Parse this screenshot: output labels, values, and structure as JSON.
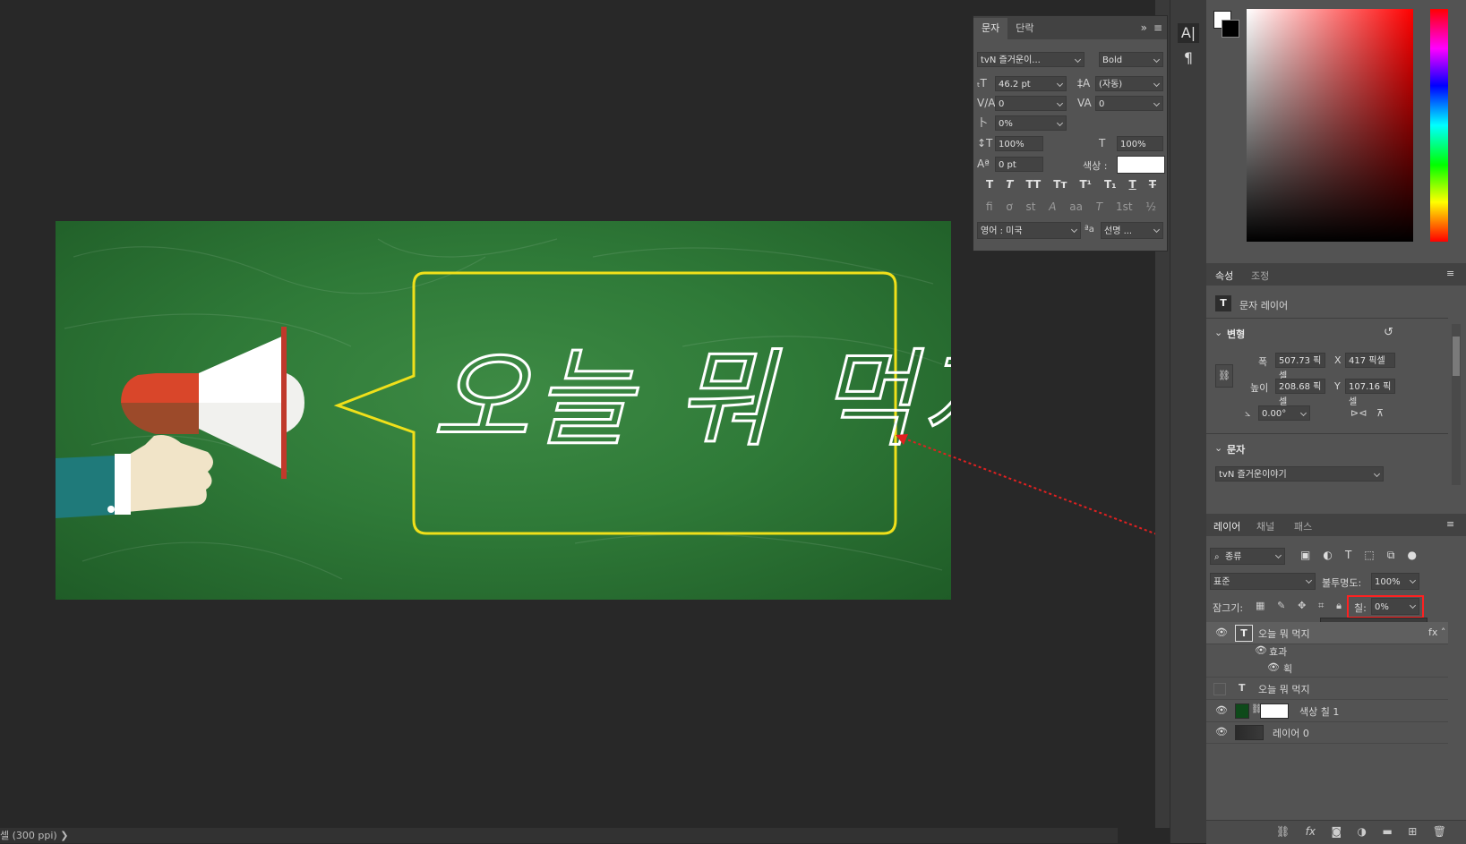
{
  "artboard": {
    "headline": "오늘 뭐 먹지",
    "colors": {
      "board": "#2f7a38",
      "bubble_stroke": "#f0e01a",
      "text_stroke": "#ffffff",
      "arrow": "#e02020"
    }
  },
  "status_bar": {
    "text": "셀 (300 ppi) ❯"
  },
  "character_panel": {
    "tabs": [
      "문자",
      "단락"
    ],
    "font_family": "tvN 즐거운이...",
    "font_style": "Bold",
    "font_size": "46.2 pt",
    "leading": "(자동)",
    "kerning": "0",
    "tracking": "0",
    "tsume": "0%",
    "vertical_scale": "100%",
    "horizontal_scale": "100%",
    "baseline_shift": "0 pt",
    "color_label": "색상 :",
    "color_value": "#ffffff",
    "style_buttons": [
      "T",
      "T",
      "TT",
      "Tт",
      "T¹",
      "T₁",
      "T",
      "T"
    ],
    "opentype_buttons": [
      "fi",
      "ơ",
      "st",
      "A",
      "aa",
      "T",
      "1st",
      "½"
    ],
    "language": "영어 : 미국",
    "antialias_icon": "ªa",
    "antialias": "선명 ..."
  },
  "tools": {
    "items": [
      "A|",
      "¶"
    ]
  },
  "properties_panel": {
    "tabs": [
      "속성",
      "조정"
    ],
    "layer_type": "문자 레이어",
    "transform_title": "변형",
    "width_label": "폭",
    "width_value": "507.73 픽셀",
    "x_label": "X",
    "x_value": "417 픽셀",
    "height_label": "높이",
    "height_value": "208.68 픽셀",
    "y_label": "Y",
    "y_value": "107.16 픽셀",
    "angle_value": "0.00°",
    "text_title": "문자",
    "font_value": "tvN 즐거운이야기"
  },
  "layers_panel": {
    "tabs": [
      "레이어",
      "채널",
      "패스"
    ],
    "filter_kind": "종류",
    "blend_mode": "표준",
    "opacity_label": "불투명도:",
    "opacity_value": "100%",
    "lock_label": "잠그기:",
    "fill_label": "칠:",
    "fill_value": "0%",
    "fill_slider": 0.0,
    "layers": [
      {
        "name": "오늘 뭐 먹지",
        "type": "text",
        "visible": true,
        "selected": true
      },
      {
        "name": "효과",
        "type": "effects",
        "visible": true
      },
      {
        "name": "획",
        "type": "effect",
        "visible": true
      },
      {
        "name": "오늘 뭐 먹지",
        "type": "text",
        "visible": false
      },
      {
        "name": "색상 칠 1",
        "type": "fill",
        "visible": true,
        "fill_color": "#0e4a1a"
      },
      {
        "name": "레이어 0",
        "type": "pixel",
        "visible": true
      }
    ],
    "bottom_icons": [
      "link-icon",
      "fx-icon",
      "mask-icon",
      "adjustment-icon",
      "folder-icon",
      "new-layer-icon",
      "trash-icon"
    ],
    "bottom_fx": "fx"
  }
}
